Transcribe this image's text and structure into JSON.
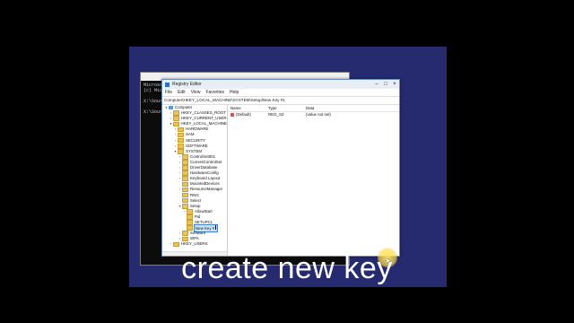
{
  "cmd": {
    "lines": [
      "Microsoft",
      "(c) Micr",
      "",
      "X:\\Sourc",
      "",
      "X:\\Sourc"
    ]
  },
  "regedit": {
    "title": "Registry Editor",
    "menu": [
      "File",
      "Edit",
      "View",
      "Favorites",
      "Help"
    ],
    "address": "Computer\\HKEY_LOCAL_MACHINE\\SYSTEM\\Setup\\New Key #1",
    "tree": [
      {
        "label": "Computer",
        "icon": "computer-icon",
        "arrow": "▾",
        "indent": 0
      },
      {
        "label": "HKEY_CLASSES_ROOT",
        "icon": "folder-icon",
        "arrow": "›",
        "indent": 1
      },
      {
        "label": "HKEY_CURRENT_USER",
        "icon": "folder-icon",
        "arrow": "›",
        "indent": 1
      },
      {
        "label": "HKEY_LOCAL_MACHINE",
        "icon": "folder-icon",
        "arrow": "▾",
        "indent": 1
      },
      {
        "label": "HARDWARE",
        "icon": "folder-icon",
        "arrow": "›",
        "indent": 2
      },
      {
        "label": "SAM",
        "icon": "folder-icon",
        "arrow": "›",
        "indent": 2
      },
      {
        "label": "SECURITY",
        "icon": "folder-icon",
        "arrow": "›",
        "indent": 2
      },
      {
        "label": "SOFTWARE",
        "icon": "folder-icon",
        "arrow": "›",
        "indent": 2
      },
      {
        "label": "SYSTEM",
        "icon": "folder-icon",
        "arrow": "▾",
        "indent": 2
      },
      {
        "label": "ControlSet001",
        "icon": "folder-icon",
        "arrow": "›",
        "indent": 3
      },
      {
        "label": "CurrentControlSet",
        "icon": "folder-icon",
        "arrow": "›",
        "indent": 3
      },
      {
        "label": "DriverDatabase",
        "icon": "folder-icon",
        "arrow": "›",
        "indent": 3
      },
      {
        "label": "HardwareConfig",
        "icon": "folder-icon",
        "arrow": "›",
        "indent": 3
      },
      {
        "label": "Keyboard Layout",
        "icon": "folder-icon",
        "arrow": "›",
        "indent": 3
      },
      {
        "label": "MountedDevices",
        "icon": "folder-icon",
        "arrow": "",
        "indent": 3
      },
      {
        "label": "ResourceManager",
        "icon": "folder-icon",
        "arrow": "›",
        "indent": 3
      },
      {
        "label": "RNG",
        "icon": "folder-icon",
        "arrow": "",
        "indent": 3
      },
      {
        "label": "Select",
        "icon": "folder-icon",
        "arrow": "",
        "indent": 3
      },
      {
        "label": "Setup",
        "icon": "folder-icon",
        "arrow": "▾",
        "indent": 3
      },
      {
        "label": "AllowStart",
        "icon": "folder-icon",
        "arrow": "›",
        "indent": 4
      },
      {
        "label": "Pid",
        "icon": "folder-icon",
        "arrow": "",
        "indent": 4
      },
      {
        "label": "SETUPCL",
        "icon": "folder-icon",
        "arrow": "",
        "indent": 4
      },
      {
        "label": "New Key #",
        "icon": "folder-icon",
        "arrow": "",
        "indent": 4,
        "selected": true
      },
      {
        "label": "Software",
        "icon": "folder-icon",
        "arrow": "›",
        "indent": 3
      },
      {
        "label": "WPA",
        "icon": "folder-icon",
        "arrow": "›",
        "indent": 3
      },
      {
        "label": "HKEY_USERS",
        "icon": "folder-icon",
        "arrow": "›",
        "indent": 1
      }
    ],
    "list": {
      "headers": [
        "Name",
        "Type",
        "Data"
      ],
      "rows": [
        {
          "name": "(Default)",
          "type": "REG_SZ",
          "data": "(value not set)"
        }
      ]
    }
  },
  "caption": "create new key",
  "colors": {
    "desktop": "#262a6e",
    "caption": "#ffffff",
    "highlight": "#ffd84d"
  }
}
